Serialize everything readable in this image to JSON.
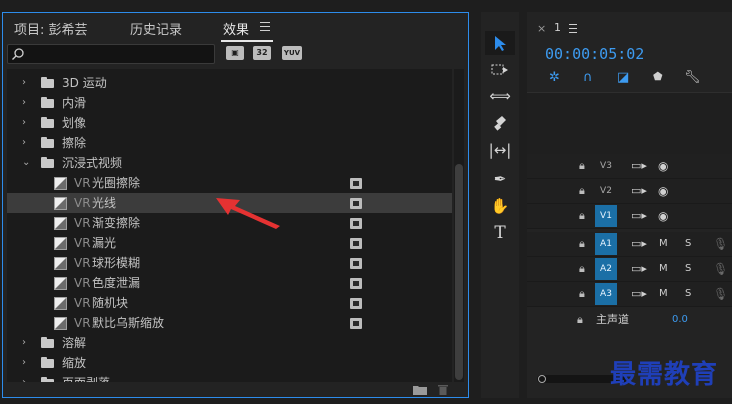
{
  "effects_panel": {
    "tabs": [
      {
        "label": "项目: 彭希芸"
      },
      {
        "label": "历史记录"
      },
      {
        "label": "效果"
      }
    ],
    "search": {
      "value": "",
      "placeholder": ""
    },
    "badges": [
      "32",
      "YUV"
    ],
    "tree": [
      {
        "type": "folder",
        "label": "3D 运动",
        "expanded": false
      },
      {
        "type": "folder",
        "label": "内滑",
        "expanded": false
      },
      {
        "type": "folder",
        "label": "划像",
        "expanded": false
      },
      {
        "type": "folder",
        "label": "擦除",
        "expanded": false
      },
      {
        "type": "folder",
        "label": "沉浸式视频",
        "expanded": true
      },
      {
        "type": "effect",
        "prefix": "VR",
        "label": "光圈擦除"
      },
      {
        "type": "effect",
        "prefix": "VR",
        "label": "光线",
        "selected": true
      },
      {
        "type": "effect",
        "prefix": "VR",
        "label": "渐变擦除"
      },
      {
        "type": "effect",
        "prefix": "VR",
        "label": "漏光"
      },
      {
        "type": "effect",
        "prefix": "VR",
        "label": "球形模糊"
      },
      {
        "type": "effect",
        "prefix": "VR",
        "label": "色度泄漏"
      },
      {
        "type": "effect",
        "prefix": "VR",
        "label": "随机块"
      },
      {
        "type": "effect",
        "prefix": "VR",
        "label": "默比乌斯缩放"
      },
      {
        "type": "folder",
        "label": "溶解",
        "expanded": false
      },
      {
        "type": "folder",
        "label": "缩放",
        "expanded": false
      },
      {
        "type": "folder",
        "label": "页面剥落",
        "expanded": false
      }
    ]
  },
  "timeline": {
    "close_glyph": "×",
    "sequence_label": "1",
    "timecode": "00:00:05:02",
    "video_tracks": [
      {
        "name": "V3",
        "target": false
      },
      {
        "name": "V2",
        "target": false
      },
      {
        "name": "V1",
        "target": true
      }
    ],
    "audio_tracks": [
      {
        "name": "A1",
        "m": "M",
        "s": "S"
      },
      {
        "name": "A2",
        "m": "M",
        "s": "S"
      },
      {
        "name": "A3",
        "m": "M",
        "s": "S"
      }
    ],
    "master": {
      "label": "主声道",
      "value": "0.0"
    }
  },
  "watermark": "最需教育",
  "colors": {
    "accent": "#2d8ceb",
    "track_target": "#1b6fa6",
    "arrow": "#e53232"
  }
}
